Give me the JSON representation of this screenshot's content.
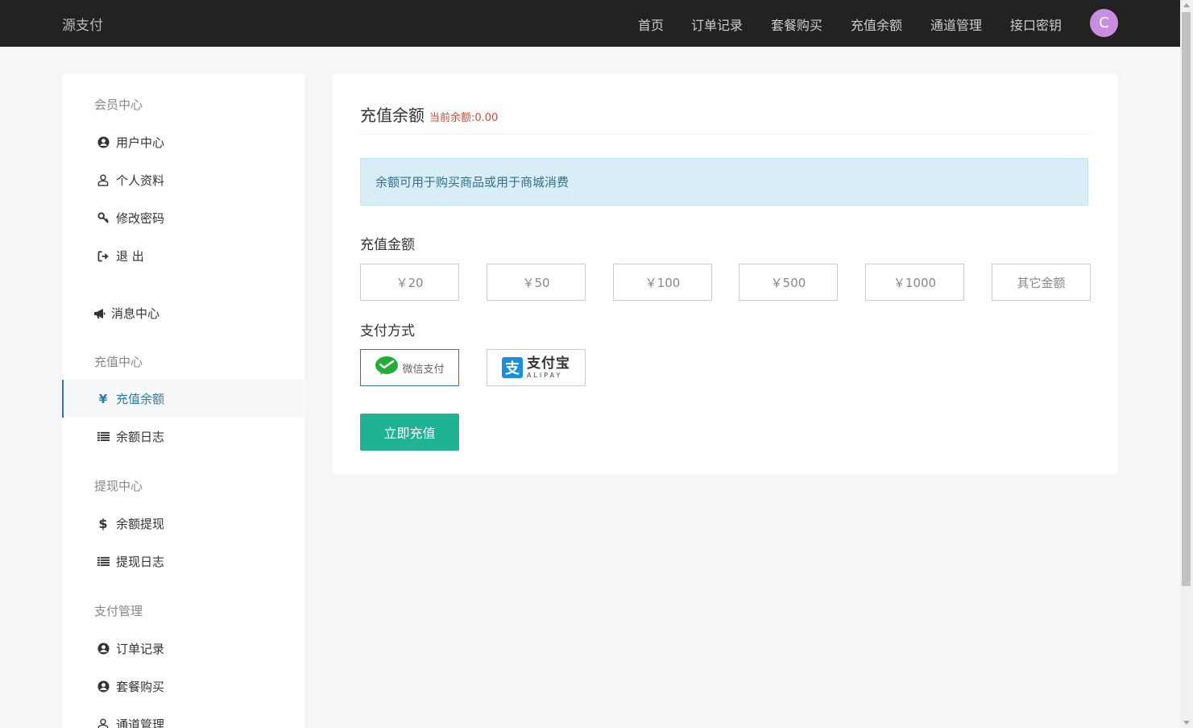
{
  "brand": "源支付",
  "nav": {
    "items": [
      "首页",
      "订单记录",
      "套餐购买",
      "充值余额",
      "通道管理",
      "接口密钥"
    ],
    "avatar_letter": "C"
  },
  "sidebar": {
    "sections": {
      "member": "会员中心",
      "recharge": "充值中心",
      "withdraw": "提现中心",
      "payment": "支付管理"
    },
    "items": {
      "user_center": "用户中心",
      "profile": "个人资料",
      "change_password": "修改密码",
      "logout": "退 出",
      "messages": "消息中心",
      "recharge_balance": "充值余额",
      "balance_log": "余额日志",
      "withdraw_balance": "余额提现",
      "withdraw_log": "提现日志",
      "orders": "订单记录",
      "packages": "套餐购买",
      "channels": "通道管理"
    },
    "active_color": "#2a7ab0"
  },
  "main": {
    "title": "充值余额",
    "balance_text": "当前余额:0.00",
    "alert": "余额可用于购买商品或用于商城消费",
    "amount_label": "充值金额",
    "amounts": [
      "￥20",
      "￥50",
      "￥100",
      "￥500",
      "￥1000",
      "其它金额"
    ],
    "payment_label": "支付方式",
    "wechat_label": "微信支付",
    "alipay_cn": "支付宝",
    "alipay_en": "ALIPAY",
    "alipay_glyph": "支",
    "submit_label": "立即充值",
    "accent_color": "#1fb393"
  }
}
